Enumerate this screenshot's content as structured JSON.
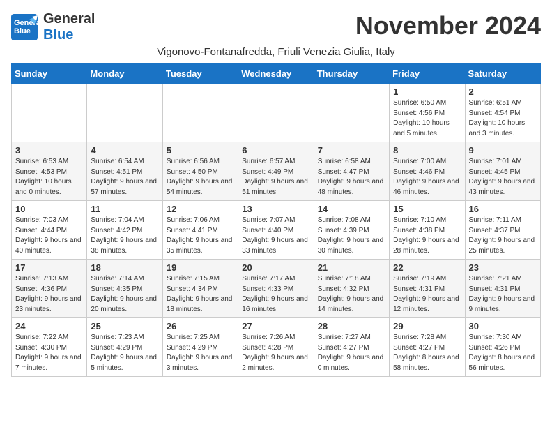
{
  "header": {
    "logo_general": "General",
    "logo_blue": "Blue",
    "month_title": "November 2024",
    "location": "Vigonovo-Fontanafredda, Friuli Venezia Giulia, Italy"
  },
  "weekdays": [
    "Sunday",
    "Monday",
    "Tuesday",
    "Wednesday",
    "Thursday",
    "Friday",
    "Saturday"
  ],
  "weeks": [
    [
      {
        "day": "",
        "info": ""
      },
      {
        "day": "",
        "info": ""
      },
      {
        "day": "",
        "info": ""
      },
      {
        "day": "",
        "info": ""
      },
      {
        "day": "",
        "info": ""
      },
      {
        "day": "1",
        "info": "Sunrise: 6:50 AM\nSunset: 4:56 PM\nDaylight: 10 hours\nand 5 minutes."
      },
      {
        "day": "2",
        "info": "Sunrise: 6:51 AM\nSunset: 4:54 PM\nDaylight: 10 hours\nand 3 minutes."
      }
    ],
    [
      {
        "day": "3",
        "info": "Sunrise: 6:53 AM\nSunset: 4:53 PM\nDaylight: 10 hours\nand 0 minutes."
      },
      {
        "day": "4",
        "info": "Sunrise: 6:54 AM\nSunset: 4:51 PM\nDaylight: 9 hours\nand 57 minutes."
      },
      {
        "day": "5",
        "info": "Sunrise: 6:56 AM\nSunset: 4:50 PM\nDaylight: 9 hours\nand 54 minutes."
      },
      {
        "day": "6",
        "info": "Sunrise: 6:57 AM\nSunset: 4:49 PM\nDaylight: 9 hours\nand 51 minutes."
      },
      {
        "day": "7",
        "info": "Sunrise: 6:58 AM\nSunset: 4:47 PM\nDaylight: 9 hours\nand 48 minutes."
      },
      {
        "day": "8",
        "info": "Sunrise: 7:00 AM\nSunset: 4:46 PM\nDaylight: 9 hours\nand 46 minutes."
      },
      {
        "day": "9",
        "info": "Sunrise: 7:01 AM\nSunset: 4:45 PM\nDaylight: 9 hours\nand 43 minutes."
      }
    ],
    [
      {
        "day": "10",
        "info": "Sunrise: 7:03 AM\nSunset: 4:44 PM\nDaylight: 9 hours\nand 40 minutes."
      },
      {
        "day": "11",
        "info": "Sunrise: 7:04 AM\nSunset: 4:42 PM\nDaylight: 9 hours\nand 38 minutes."
      },
      {
        "day": "12",
        "info": "Sunrise: 7:06 AM\nSunset: 4:41 PM\nDaylight: 9 hours\nand 35 minutes."
      },
      {
        "day": "13",
        "info": "Sunrise: 7:07 AM\nSunset: 4:40 PM\nDaylight: 9 hours\nand 33 minutes."
      },
      {
        "day": "14",
        "info": "Sunrise: 7:08 AM\nSunset: 4:39 PM\nDaylight: 9 hours\nand 30 minutes."
      },
      {
        "day": "15",
        "info": "Sunrise: 7:10 AM\nSunset: 4:38 PM\nDaylight: 9 hours\nand 28 minutes."
      },
      {
        "day": "16",
        "info": "Sunrise: 7:11 AM\nSunset: 4:37 PM\nDaylight: 9 hours\nand 25 minutes."
      }
    ],
    [
      {
        "day": "17",
        "info": "Sunrise: 7:13 AM\nSunset: 4:36 PM\nDaylight: 9 hours\nand 23 minutes."
      },
      {
        "day": "18",
        "info": "Sunrise: 7:14 AM\nSunset: 4:35 PM\nDaylight: 9 hours\nand 20 minutes."
      },
      {
        "day": "19",
        "info": "Sunrise: 7:15 AM\nSunset: 4:34 PM\nDaylight: 9 hours\nand 18 minutes."
      },
      {
        "day": "20",
        "info": "Sunrise: 7:17 AM\nSunset: 4:33 PM\nDaylight: 9 hours\nand 16 minutes."
      },
      {
        "day": "21",
        "info": "Sunrise: 7:18 AM\nSunset: 4:32 PM\nDaylight: 9 hours\nand 14 minutes."
      },
      {
        "day": "22",
        "info": "Sunrise: 7:19 AM\nSunset: 4:31 PM\nDaylight: 9 hours\nand 12 minutes."
      },
      {
        "day": "23",
        "info": "Sunrise: 7:21 AM\nSunset: 4:31 PM\nDaylight: 9 hours\nand 9 minutes."
      }
    ],
    [
      {
        "day": "24",
        "info": "Sunrise: 7:22 AM\nSunset: 4:30 PM\nDaylight: 9 hours\nand 7 minutes."
      },
      {
        "day": "25",
        "info": "Sunrise: 7:23 AM\nSunset: 4:29 PM\nDaylight: 9 hours\nand 5 minutes."
      },
      {
        "day": "26",
        "info": "Sunrise: 7:25 AM\nSunset: 4:29 PM\nDaylight: 9 hours\nand 3 minutes."
      },
      {
        "day": "27",
        "info": "Sunrise: 7:26 AM\nSunset: 4:28 PM\nDaylight: 9 hours\nand 2 minutes."
      },
      {
        "day": "28",
        "info": "Sunrise: 7:27 AM\nSunset: 4:27 PM\nDaylight: 9 hours\nand 0 minutes."
      },
      {
        "day": "29",
        "info": "Sunrise: 7:28 AM\nSunset: 4:27 PM\nDaylight: 8 hours\nand 58 minutes."
      },
      {
        "day": "30",
        "info": "Sunrise: 7:30 AM\nSunset: 4:26 PM\nDaylight: 8 hours\nand 56 minutes."
      }
    ]
  ]
}
